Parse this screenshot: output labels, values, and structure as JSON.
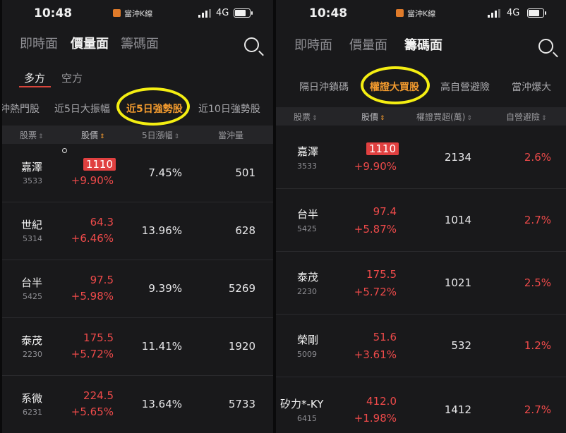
{
  "status": {
    "time": "10:48",
    "app_name": "當沖K線",
    "network": "4G"
  },
  "left": {
    "tabs": [
      "即時面",
      "價量面",
      "籌碼面"
    ],
    "directions": [
      "多方",
      "空方"
    ],
    "subtabs": [
      "沖熱門股",
      "近5日大振幅",
      "近5日強勢股",
      "近10日強勢股"
    ],
    "headers": [
      "股票",
      "股價",
      "5日漲幅",
      "當沖量"
    ],
    "rows": [
      {
        "name": "嘉澤",
        "code": "3533",
        "price": "1110",
        "change": "+9.90%",
        "metric": "7.45%",
        "volume": "501"
      },
      {
        "name": "世紀",
        "code": "5314",
        "price": "64.3",
        "change": "+6.46%",
        "metric": "13.96%",
        "volume": "628"
      },
      {
        "name": "台半",
        "code": "5425",
        "price": "97.5",
        "change": "+5.98%",
        "metric": "9.39%",
        "volume": "5269"
      },
      {
        "name": "泰茂",
        "code": "2230",
        "price": "175.5",
        "change": "+5.72%",
        "metric": "11.41%",
        "volume": "1920"
      },
      {
        "name": "系微",
        "code": "6231",
        "price": "224.5",
        "change": "+5.65%",
        "metric": "13.64%",
        "volume": "5733"
      }
    ]
  },
  "right": {
    "tabs": [
      "即時面",
      "價量面",
      "籌碼面"
    ],
    "subtabs": [
      "隔日沖鎖碼",
      "權證大買股",
      "高自營避險",
      "當沖爆大"
    ],
    "headers": [
      "股票",
      "股價",
      "權證買超(萬)",
      "自營避險"
    ],
    "rows": [
      {
        "name": "嘉澤",
        "code": "3533",
        "price": "1110",
        "change": "+9.90%",
        "buy": "2134",
        "hedge": "2.6%"
      },
      {
        "name": "台半",
        "code": "5425",
        "price": "97.4",
        "change": "+5.87%",
        "buy": "1014",
        "hedge": "2.7%"
      },
      {
        "name": "泰茂",
        "code": "2230",
        "price": "175.5",
        "change": "+5.72%",
        "buy": "1021",
        "hedge": "2.5%"
      },
      {
        "name": "榮剛",
        "code": "5009",
        "price": "51.6",
        "change": "+3.61%",
        "buy": "532",
        "hedge": "1.2%"
      },
      {
        "name": "矽力*-KY",
        "code": "6415",
        "price": "412.0",
        "change": "+1.98%",
        "buy": "1412",
        "hedge": "2.7%"
      }
    ]
  },
  "colors": {
    "up": "#ee4a4a",
    "accent": "#f29a2e",
    "highlight": "#f4ee12",
    "background": "#19191b"
  }
}
